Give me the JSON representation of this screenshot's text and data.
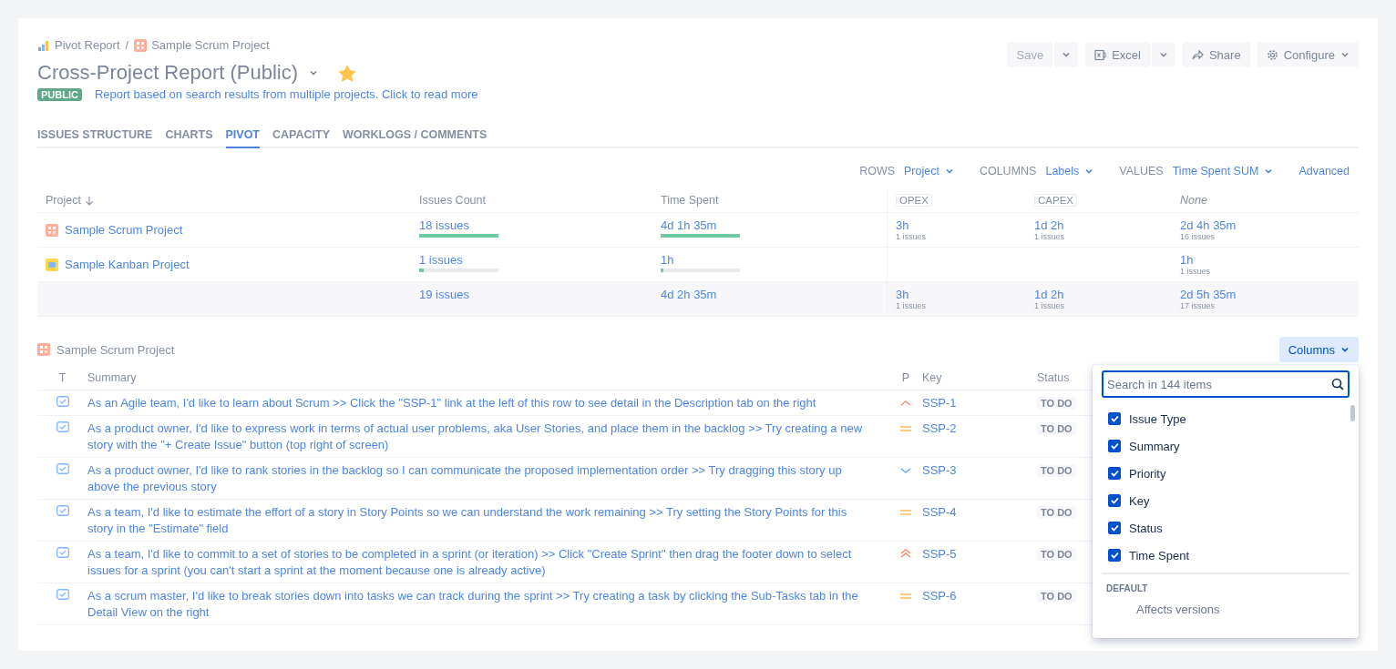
{
  "breadcrumb": {
    "items": [
      {
        "label": "Pivot Report",
        "kind": "report"
      },
      {
        "label": "Sample Scrum Project",
        "kind": "scrum"
      }
    ],
    "separator": "/"
  },
  "title": "Cross-Project Report (Public)",
  "starred": true,
  "badge": "PUBLIC",
  "description": "Report based on search results from multiple projects. Click to read more",
  "toolbar": [
    {
      "kind": "save",
      "label": "Save",
      "disabled": true
    },
    {
      "kind": "excel",
      "label": "Excel",
      "disabled": false
    },
    {
      "kind": "share",
      "label": "Share",
      "disabled": false
    },
    {
      "kind": "configure",
      "label": "Configure",
      "disabled": false
    }
  ],
  "tabs": [
    {
      "label": "ISSUES STRUCTURE",
      "selected": false
    },
    {
      "label": "CHARTS",
      "selected": false
    },
    {
      "label": "PIVOT",
      "selected": true
    },
    {
      "label": "CAPACITY",
      "selected": false
    },
    {
      "label": "WORKLOGS / COMMENTS",
      "selected": false
    }
  ],
  "pivot_controls": [
    {
      "label": "ROWS",
      "value": "Project"
    },
    {
      "label": "COLUMNS",
      "value": "Labels"
    },
    {
      "label": "VALUES",
      "value": "Time Spent SUM"
    }
  ],
  "advanced": "Advanced",
  "pivot": {
    "columns": [
      {
        "label": "Project",
        "kind": "sort"
      },
      {
        "label": "Issues Count",
        "kind": "plain"
      },
      {
        "label": "Time Spent",
        "kind": "plain"
      },
      {
        "label": "OPEX",
        "kind": "tag"
      },
      {
        "label": "CAPEX",
        "kind": "tag"
      },
      {
        "label": "None",
        "kind": "empty"
      }
    ],
    "rows": [
      {
        "project": "Sample Scrum Project",
        "kind": "scrum",
        "issues": {
          "text": "18 issues",
          "level": 1
        },
        "time": {
          "text": "4d 1h 35m",
          "level": 1
        },
        "opex": {
          "value": "3h",
          "sub": "1 issues"
        },
        "capex": {
          "value": "1d 2h",
          "sub": "1 issues"
        },
        "none": {
          "value": "2d 4h 35m",
          "sub": "16 issues"
        }
      },
      {
        "project": "Sample Kanban Project",
        "kind": "kanban",
        "issues": {
          "text": "1 issues",
          "level": 0.06
        },
        "time": {
          "text": "1h",
          "level": 0.04
        },
        "none": {
          "value": "1h",
          "sub": "1 issues"
        }
      }
    ],
    "total": {
      "issues": "19 issues",
      "time": "4d 2h 35m",
      "opex": {
        "value": "3h",
        "sub": "1 issues"
      },
      "capex": {
        "value": "1d 2h",
        "sub": "1 issues"
      },
      "none": {
        "value": "2d 5h 35m",
        "sub": "17 issues"
      }
    }
  },
  "section": {
    "title": "Sample Scrum Project",
    "kind": "scrum",
    "columns_button": "Columns"
  },
  "issues": {
    "columns": [
      "T",
      "Summary",
      "P",
      "Key",
      "Status"
    ],
    "rows": [
      {
        "summary": "As an Agile team, I'd like to learn about Scrum >> Click the \"SSP-1\" link at the left of this row to see detail in the Description tab on the right",
        "kind": "high",
        "key": "SSP-1",
        "status": "TO DO"
      },
      {
        "summary": "As a product owner, I'd like to express work in terms of actual user problems, aka User Stories, and place them in the backlog >> Try creating a new story with the \"+ Create Issue\" button (top right of screen)",
        "kind": "medium",
        "key": "SSP-2",
        "status": "TO DO"
      },
      {
        "summary": "As a product owner, I'd like to rank stories in the backlog so I can communicate the proposed implementation order >> Try dragging this story up above the previous story",
        "kind": "low",
        "key": "SSP-3",
        "status": "TO DO"
      },
      {
        "summary": "As a team, I'd like to estimate the effort of a story in Story Points so we can understand the work remaining >> Try setting the Story Points for this story in the \"Estimate\" field",
        "kind": "medium",
        "key": "SSP-4",
        "status": "TO DO"
      },
      {
        "summary": "As a team, I'd like to commit to a set of stories to be completed in a sprint (or iteration) >> Click \"Create Sprint\" then drag the footer down to select issues for a sprint (you can't start a sprint at the moment because one is already active)",
        "kind": "highest",
        "key": "SSP-5",
        "status": "TO DO"
      },
      {
        "summary": "As a scrum master, I'd like to break stories down into tasks we can track during the sprint >> Try creating a task by clicking the Sub-Tasks tab in the Detail View on the right",
        "kind": "medium",
        "key": "SSP-6",
        "status": "TO DO"
      }
    ]
  },
  "column_picker": {
    "placeholder": "Search in 144 items",
    "items": [
      {
        "label": "Issue Type",
        "checked": true
      },
      {
        "label": "Summary",
        "checked": true
      },
      {
        "label": "Priority",
        "checked": true
      },
      {
        "label": "Key",
        "checked": true
      },
      {
        "label": "Status",
        "checked": true
      },
      {
        "label": "Time Spent",
        "checked": true
      }
    ],
    "group": "DEFAULT",
    "group_items": [
      {
        "label": "Affects versions",
        "checked": false
      }
    ]
  }
}
